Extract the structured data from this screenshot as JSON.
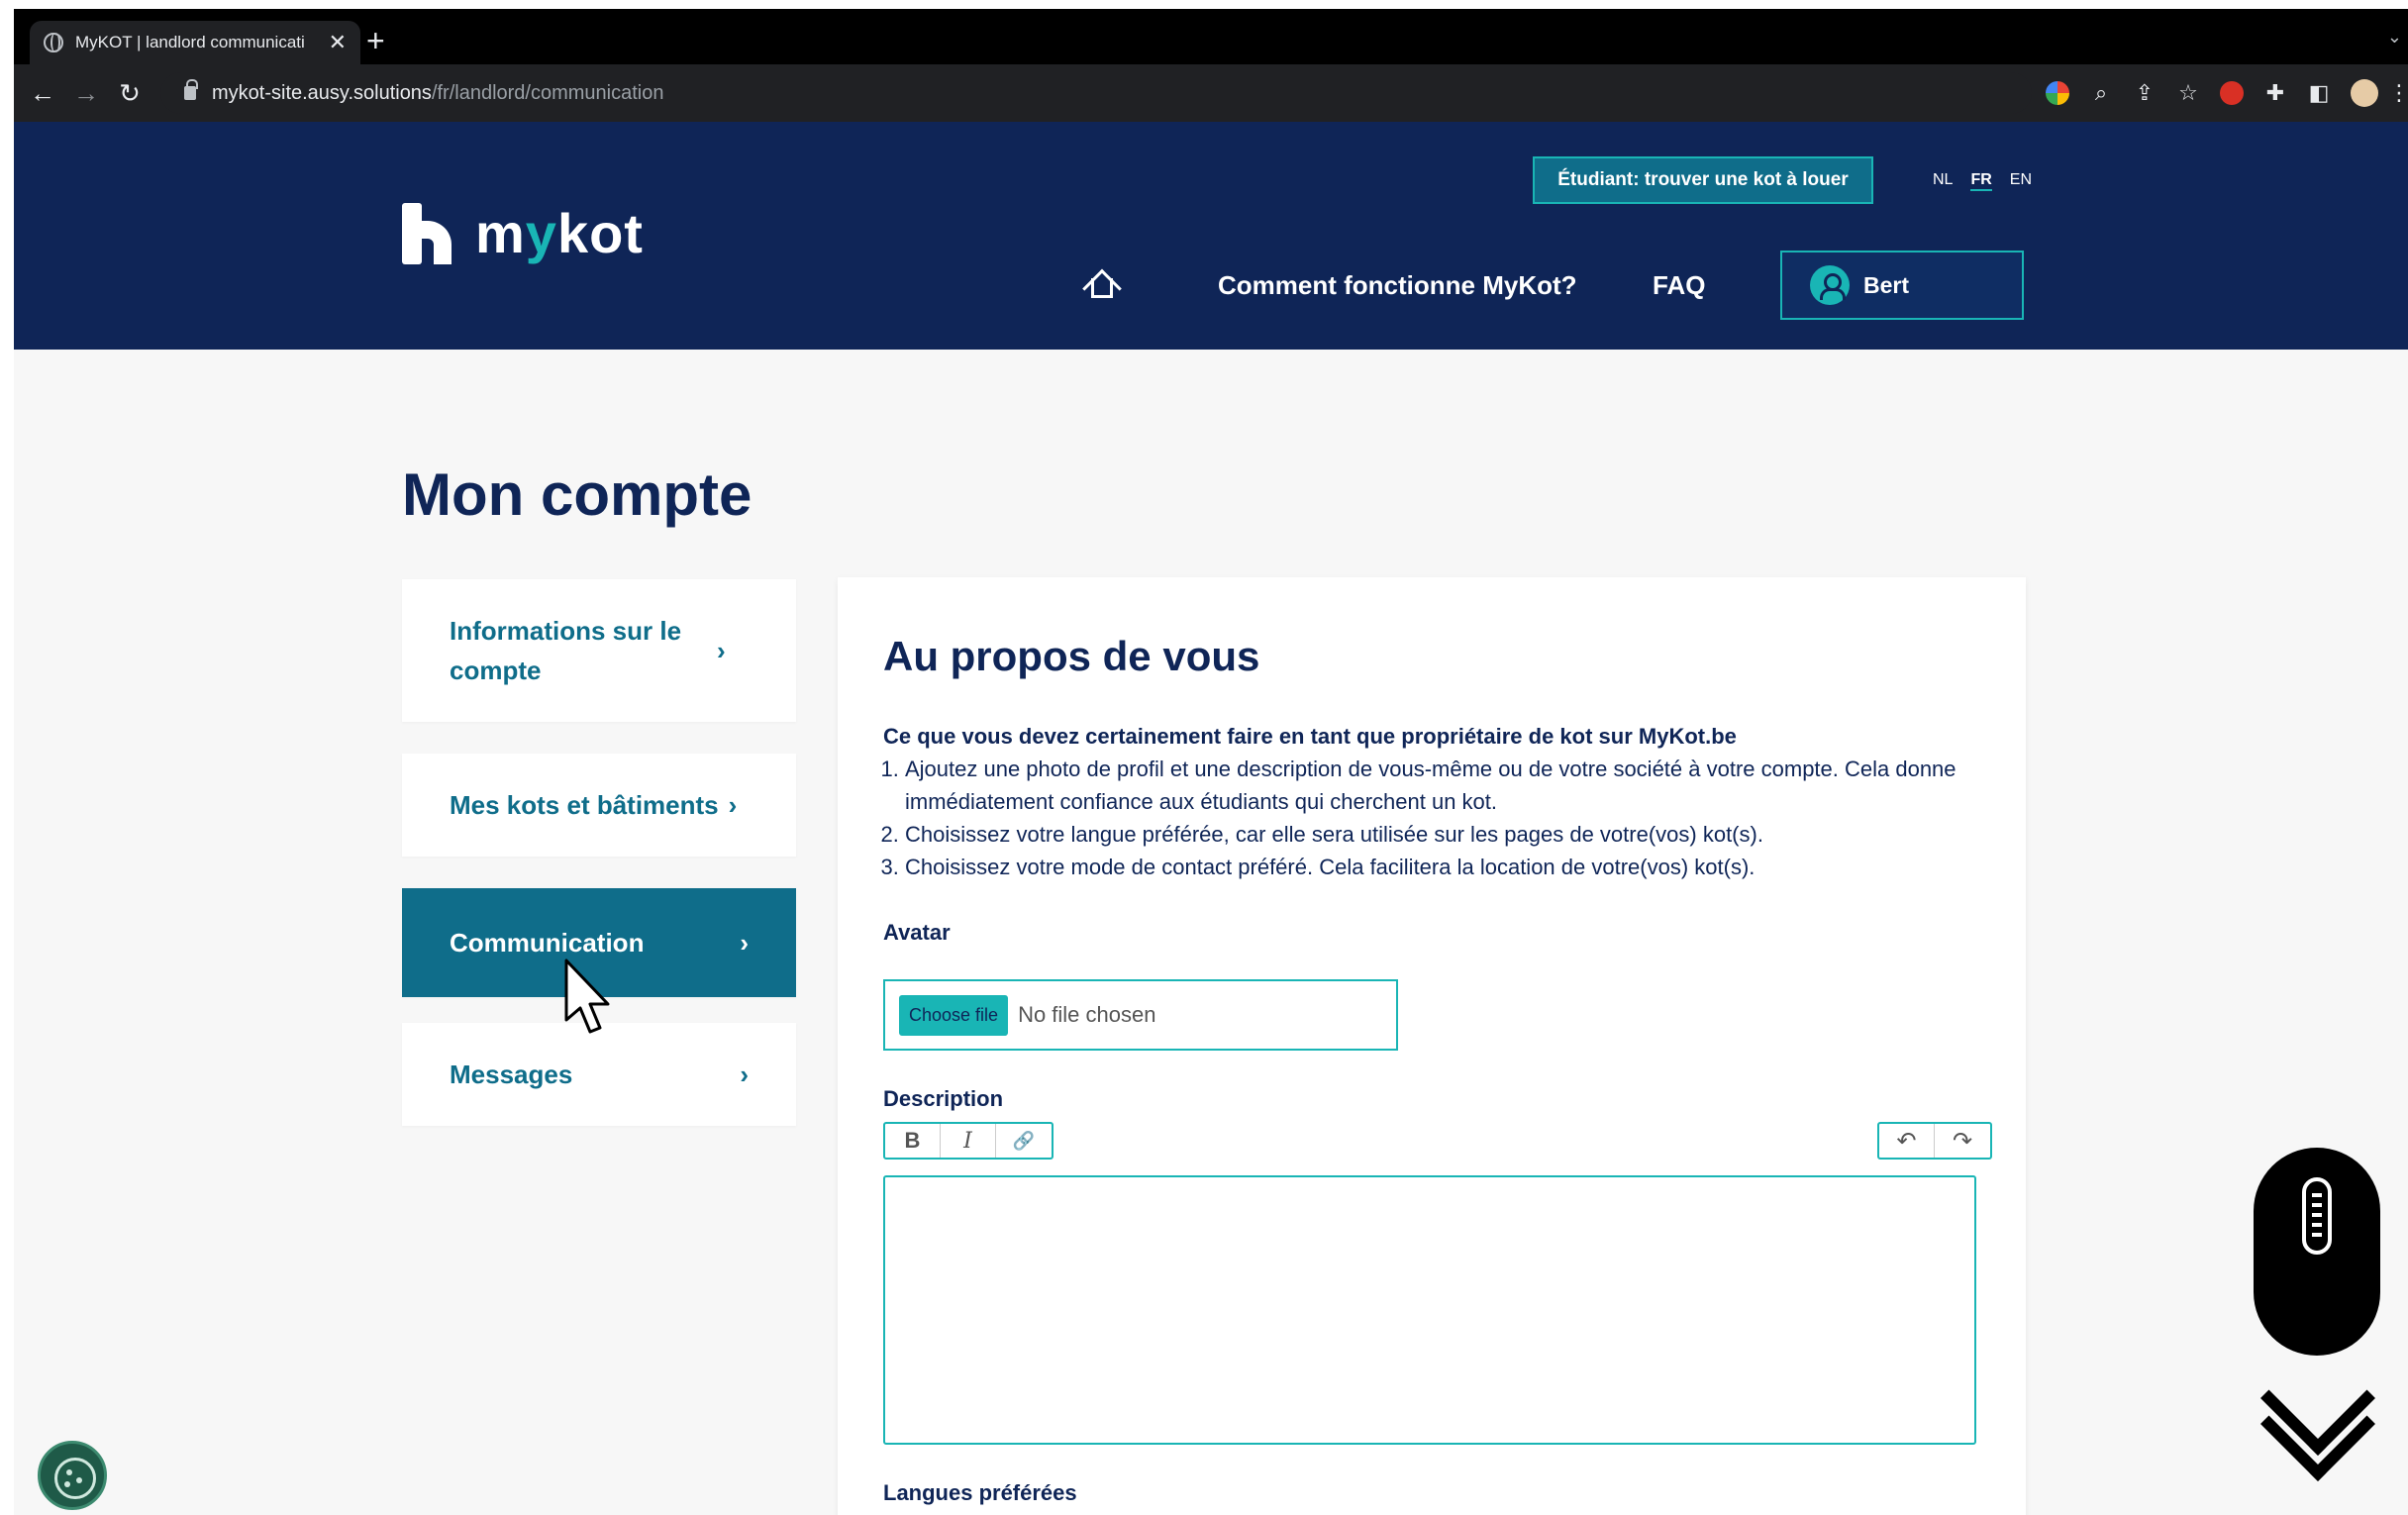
{
  "browser": {
    "tab_title": "MyKOT | landlord communicati",
    "tab_close": "✕",
    "new_tab": "+",
    "url_host": "mykot-site.ausy.solutions",
    "url_path": "/fr/landlord/communication"
  },
  "header": {
    "logo_text_before": "m",
    "logo_text_y": "y",
    "logo_text_after": "kot",
    "student_button": "Étudiant: trouver une kot à louer",
    "langs": [
      "NL",
      "FR",
      "EN"
    ],
    "active_lang": "FR",
    "nav": {
      "how_it_works": "Comment fonctionne MyKot?",
      "faq": "FAQ"
    },
    "user_name": "Bert"
  },
  "page": {
    "title": "Mon compte"
  },
  "sidebar": {
    "items": [
      {
        "label": "Informations sur le compte",
        "active": false
      },
      {
        "label": "Mes kots et bâtiments",
        "active": false
      },
      {
        "label": "Communication",
        "active": true
      },
      {
        "label": "Messages",
        "active": false
      }
    ],
    "chevron": "›"
  },
  "card": {
    "title": "Au propos de vous",
    "lead": "Ce que vous devez certainement faire en tant que propriétaire de kot sur MyKot.be",
    "steps": [
      "Ajoutez une photo de profil et une description de vous-même ou de votre société à votre compte. Cela donne immédiatement confiance aux étudiants qui cherchent un kot.",
      "Choisissez votre langue préférée, car elle sera utilisée sur les pages de votre(vos) kot(s).",
      "Choisissez votre mode de contact préféré. Cela facilitera la location de votre(vos) kot(s)."
    ],
    "avatar_label": "Avatar",
    "choose_file": "Choose file",
    "no_file": "No file chosen",
    "description_label": "Description",
    "editor_bold": "B",
    "editor_italic": "I",
    "editor_link": "🔗",
    "editor_undo": "↶",
    "editor_redo": "↷",
    "languages_label": "Langues préférées"
  },
  "colors": {
    "navy": "#0f2557",
    "teal": "#19b5b5",
    "active_item": "#0f6d8a"
  }
}
